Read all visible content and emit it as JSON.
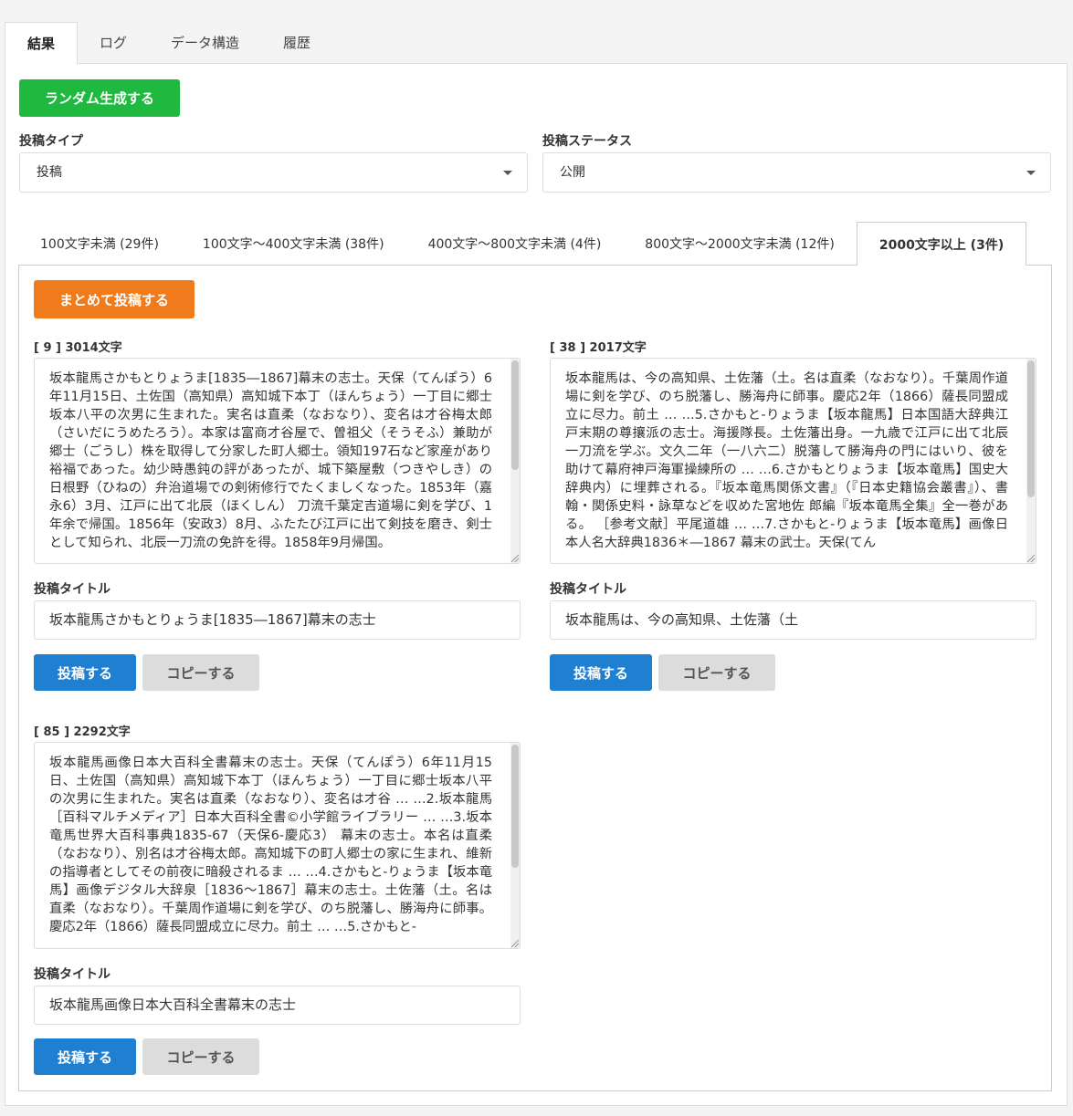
{
  "top_tabs": [
    "結果",
    "ログ",
    "データ構造",
    "履歴"
  ],
  "random_button": "ランダム生成する",
  "post_type": {
    "label": "投稿タイプ",
    "value": "投稿"
  },
  "post_status": {
    "label": "投稿ステータス",
    "value": "公開"
  },
  "length_tabs": [
    "100文字未満 (29件)",
    "100文字～400文字未満 (38件)",
    "400文字～800文字未満 (4件)",
    "800文字～2000文字未満 (12件)",
    "2000文字以上 (3件)"
  ],
  "bulk_post_button": "まとめて投稿する",
  "title_label": "投稿タイトル",
  "post_button": "投稿する",
  "copy_button": "コピーする",
  "cards": [
    {
      "count": "[ 9 ] 3014文字",
      "body": "坂本龍馬さかもとりょうま[1835―1867]幕末の志士。天保（てんぽう）6年11月15日、土佐国（高知県）高知城下本丁（ほんちょう）一丁目に郷士坂本八平の次男に生まれた。実名は直柔（なおなり）、変名は才谷梅太郎（さいだにうめたろう）。本家は富商才谷屋で、曽祖父（そうそふ）兼助が郷士（ごうし）株を取得して分家した町人郷士。領知197石など家産があり裕福であった。幼少時愚鈍の評があったが、城下築屋敷（つきやしき）の日根野（ひねの）弁治道場での剣術修行でたくましくなった。1853年（嘉永6）3月、江戸に出て北辰（ほくしん） 刀流千葉定吉道場に剣を学び、1年余で帰国。1856年（安政3）8月、ふたたび江戸に出て剣技を磨き、剣士として知られ、北辰一刀流の免許を得。1858年9月帰国。",
      "title": "坂本龍馬さかもとりょうま[1835―1867]幕末の志士"
    },
    {
      "count": "[ 38 ] 2017文字",
      "body": "坂本龍馬は、今の高知県、土佐藩（土。名は直柔（なおなり）。千葉周作道場に剣を学び、のち脱藩し、勝海舟に師事。慶応2年（1866）薩長同盟成立に尽力。前土 … …5.さかもと-りょうま【坂本龍馬】日本国語大辞典江戸末期の尊攘派の志士。海援隊長。土佐藩出身。一九歳で江戸に出て北辰一刀流を学ぶ。文久二年（一八六二）脱藩して勝海舟の門にはいり、彼を助けて幕府神戸海軍操練所の … …6.さかもとりょうま【坂本竜馬】国史大辞典内）に埋葬される。『坂本竜馬関係文書』（『日本史籍協会叢書』）、書翰・関係史料・詠草などを収めた宮地佐 郎編『坂本竜馬全集』全一巻がある。 ［参考文献］平尾道雄 … …7.さかもと-りょうま【坂本竜馬】画像日本人名大辞典1836＊―1867 幕末の武士。天保(てん",
      "title": "坂本龍馬は、今の高知県、土佐藩（土"
    },
    {
      "count": "[ 85 ] 2292文字",
      "body": "坂本龍馬画像日本大百科全書幕末の志士。天保（てんぽう）6年11月15日、土佐国（高知県）高知城下本丁（ほんちょう）一丁目に郷士坂本八平の次男に生まれた。実名は直柔（なおなり）、変名は才谷 … …2.坂本龍馬［百科マルチメディア］日本大百科全書©小学館ライブラリー … …3.坂本竜馬世界大百科事典1835-67（天保6-慶応3） 幕末の志士。本名は直柔（なおなり）、別名は才谷梅太郎。高知城下の町人郷士の家に生まれ、維新の指導者としてその前夜に暗殺されるま … …4.さかもと-りょうま【坂本竜馬】画像デジタル大辞泉［1836～1867］幕末の志士。土佐藩（土。名は直柔（なおなり）。千葉周作道場に剣を学び、のち脱藩し、勝海舟に師事。慶応2年（1866）薩長同盟成立に尽力。前土 … …5.さかもと-",
      "title": "坂本龍馬画像日本大百科全書幕末の志士"
    }
  ]
}
